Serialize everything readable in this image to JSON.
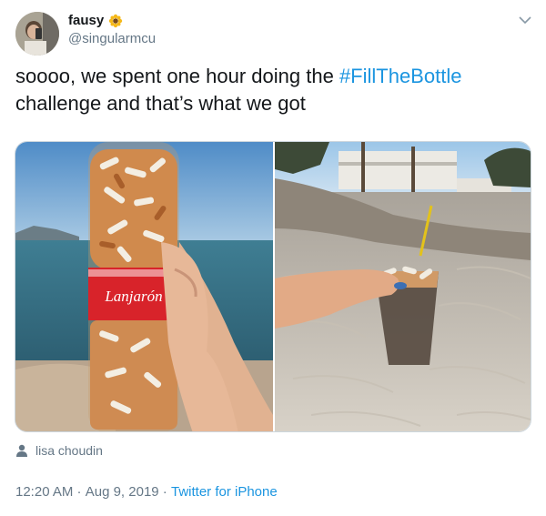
{
  "author": {
    "display_name": "fausy",
    "handle": "@singularmcu",
    "emoji_icon": "sunflower-icon"
  },
  "tweet": {
    "text_before": "soooo, we spent one hour doing the ",
    "hashtag": "#FillTheBottle",
    "text_after": " challenge and that’s what we got"
  },
  "media": {
    "bottle_brand": "Lanjarón"
  },
  "tagged_user": "lisa choudin",
  "meta": {
    "time": "12:20 AM",
    "sep1": " · ",
    "date": "Aug 9, 2019",
    "sep2": " · ",
    "source": "Twitter for iPhone"
  },
  "colors": {
    "link": "#1b95e0",
    "secondary_text": "#657786",
    "border": "#ccd6dd"
  }
}
